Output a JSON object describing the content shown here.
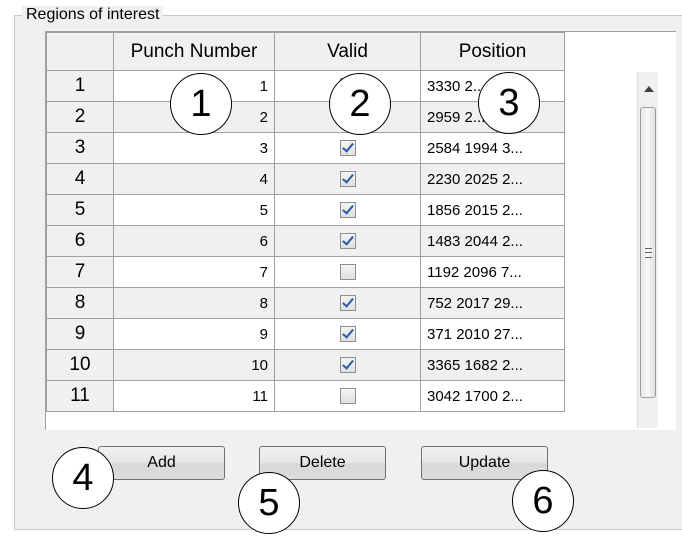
{
  "group_title": "Regions of interest",
  "table": {
    "headers": [
      "",
      "Punch Number",
      "Valid",
      "Position"
    ],
    "rows": [
      {
        "row": "1",
        "punch": "1",
        "valid": false,
        "position": "3330 2..."
      },
      {
        "row": "2",
        "punch": "2",
        "valid": false,
        "position": "2959 2..."
      },
      {
        "row": "3",
        "punch": "3",
        "valid": true,
        "position": "2584 1994 3..."
      },
      {
        "row": "4",
        "punch": "4",
        "valid": true,
        "position": "2230 2025 2..."
      },
      {
        "row": "5",
        "punch": "5",
        "valid": true,
        "position": "1856 2015 2..."
      },
      {
        "row": "6",
        "punch": "6",
        "valid": true,
        "position": "1483 2044 2..."
      },
      {
        "row": "7",
        "punch": "7",
        "valid": false,
        "position": "1192 2096 7..."
      },
      {
        "row": "8",
        "punch": "8",
        "valid": true,
        "position": "752 2017 29..."
      },
      {
        "row": "9",
        "punch": "9",
        "valid": true,
        "position": "371 2010 27..."
      },
      {
        "row": "10",
        "punch": "10",
        "valid": true,
        "position": "3365 1682 2..."
      },
      {
        "row": "11",
        "punch": "11",
        "valid": false,
        "position": "3042 1700 2..."
      }
    ]
  },
  "buttons": {
    "add": "Add",
    "delete": "Delete",
    "update": "Update"
  },
  "callouts": [
    "1",
    "2",
    "3",
    "4",
    "5",
    "6"
  ]
}
